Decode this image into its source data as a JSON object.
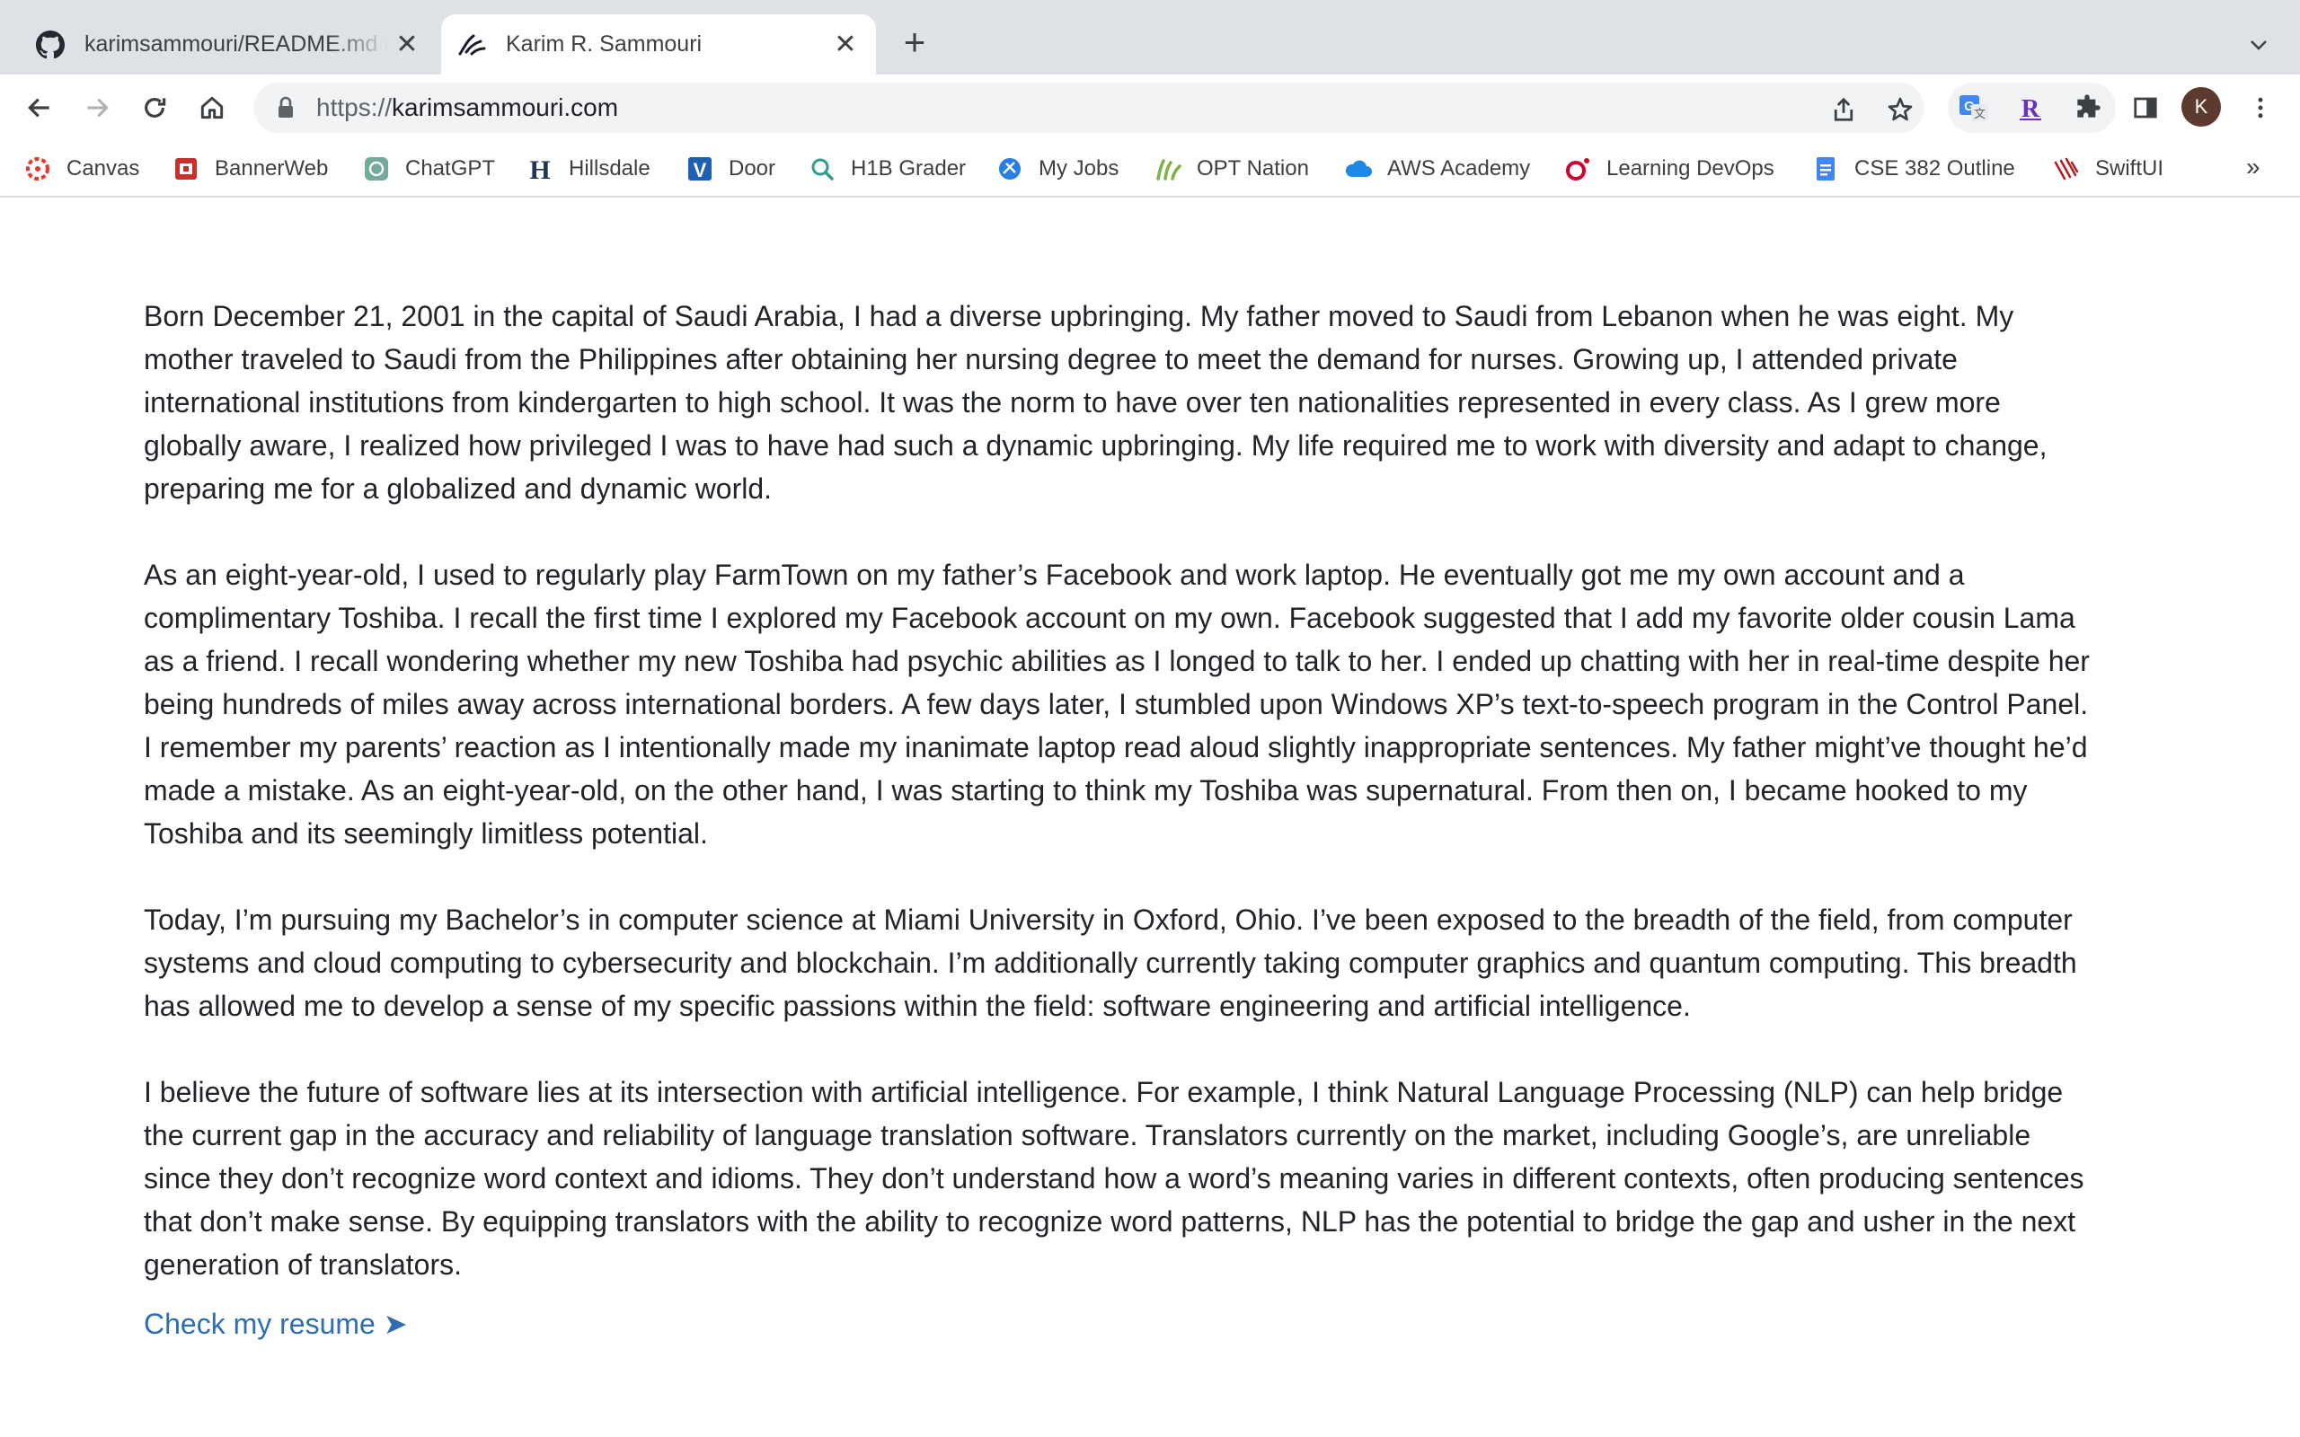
{
  "browser": {
    "tabs": [
      {
        "title": "karimsammouri/README.md at",
        "favicon": "github-icon",
        "active": false
      },
      {
        "title": "Karim R. Sammouri",
        "favicon": "site-logo-icon",
        "active": true
      }
    ],
    "new_tab_symbol": "+",
    "close_symbol": "✕",
    "url_scheme": "https://",
    "url_host": "karimsammouri.com",
    "profile_initial": "K",
    "extensions": [
      "google-translate-icon",
      "r-extension-icon",
      "puzzle-icon"
    ]
  },
  "bookmarks": [
    {
      "label": "Canvas",
      "icon": "canvas-icon",
      "color": "#e4392b"
    },
    {
      "label": "BannerWeb",
      "icon": "bannerweb-icon",
      "color": "#c8302e"
    },
    {
      "label": "ChatGPT",
      "icon": "chatgpt-icon",
      "color": "#74aa9c"
    },
    {
      "label": "Hillsdale",
      "icon": "hillsdale-icon",
      "color": "#1d3557"
    },
    {
      "label": "Door",
      "icon": "door-icon",
      "color": "#1f5fb4"
    },
    {
      "label": "H1B Grader",
      "icon": "magnifier-icon",
      "color": "#2e9e8f"
    },
    {
      "label": "My Jobs",
      "icon": "globe-icon",
      "color": "#2a7de1"
    },
    {
      "label": "OPT Nation",
      "icon": "optnation-icon",
      "color": "#7cb342"
    },
    {
      "label": "AWS Academy",
      "icon": "cloud-icon",
      "color": "#1e88e5"
    },
    {
      "label": "Learning DevOps",
      "icon": "oreilly-icon",
      "color": "#d3002d"
    },
    {
      "label": "CSE 382 Outline",
      "icon": "docs-icon",
      "color": "#4285f4"
    },
    {
      "label": "SwiftUI",
      "icon": "swiftui-icon",
      "color": "#b71c1c"
    }
  ],
  "bookmarks_more": "»",
  "content": {
    "paragraphs": [
      "Born December 21, 2001 in the capital of Saudi Arabia, I had a diverse upbringing. My father moved to Saudi from Lebanon when he was eight. My mother traveled to Saudi from the Philippines after obtaining her nursing degree to meet the demand for nurses. Growing up, I attended private international institutions from kindergarten to high school. It was the norm to have over ten nationalities represented in every class. As I grew more globally aware, I realized how privileged I was to have had such a dynamic upbringing. My life required me to work with diversity and adapt to change, preparing me for a globalized and dynamic world.",
      "As an eight-year-old, I used to regularly play FarmTown on my father’s Facebook and work laptop. He eventually got me my own account and a complimentary Toshiba. I recall the first time I explored my Facebook account on my own. Facebook suggested that I add my favorite older cousin Lama as a friend. I recall wondering whether my new Toshiba had psychic abilities as I longed to talk to her. I ended up chatting with her in real-time despite her being hundreds of miles away across international borders. A few days later, I stumbled upon Windows XP’s text-to-speech program in the Control Panel. I remember my parents’ reaction as I intentionally made my inanimate laptop read aloud slightly inappropriate sentences. My father might’ve thought he’d made a mistake. As an eight-year-old, on the other hand, I was starting to think my Toshiba was supernatural. From then on, I became hooked to my Toshiba and its seemingly limitless potential.",
      "Today, I’m pursuing my Bachelor’s in computer science at Miami University in Oxford, Ohio. I’ve been exposed to the breadth of the field, from computer systems and cloud computing to cybersecurity and blockchain. I’m additionally currently taking computer graphics and quantum computing. This breadth has allowed me to develop a sense of my specific passions within the field: software engineering and artificial intelligence.",
      "I believe the future of software lies at its intersection with artificial intelligence. For example, I think Natural Language Processing (NLP) can help bridge the current gap in the accuracy and reliability of language translation software. Translators currently on the market, including Google’s, are unreliable since they don’t recognize word context and idioms. They don’t understand how a word’s meaning varies in different contexts, often producing sentences that don’t make sense. By equipping translators with the ability to recognize word patterns, NLP has the potential to bridge the gap and usher in the next generation of translators."
    ],
    "resume_link": "Check my resume ➤",
    "link_color": "#2f6db2"
  }
}
